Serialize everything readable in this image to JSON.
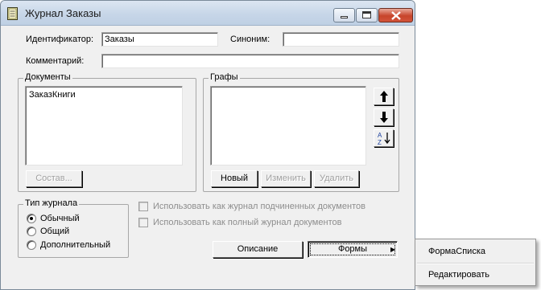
{
  "window": {
    "title": "Журнал Заказы"
  },
  "fields": {
    "identifier_label": "Идентификатор:",
    "identifier_value": "Заказы",
    "synonym_label": "Синоним:",
    "synonym_value": "",
    "comment_label": "Комментарий:",
    "comment_value": ""
  },
  "documents": {
    "title": "Документы",
    "items": [
      "ЗаказКниги"
    ],
    "compose_button": "Состав..."
  },
  "columns": {
    "title": "Графы",
    "items": [],
    "new_button": "Новый",
    "edit_button": "Изменить",
    "delete_button": "Удалить"
  },
  "journal_type": {
    "title": "Тип журнала",
    "options": [
      {
        "label": "Обычный",
        "checked": true
      },
      {
        "label": "Общий",
        "checked": false
      },
      {
        "label": "Дополнительный",
        "checked": false
      }
    ]
  },
  "checkboxes": {
    "subordinate": "Использовать как журнал подчиненных документов",
    "full": "Использовать как полный журнал документов"
  },
  "bottom_buttons": {
    "description": "Описание",
    "forms": "Формы"
  },
  "context_menu": {
    "items": [
      "ФормаСписка",
      "Редактировать"
    ]
  },
  "icons": [
    "journal-icon",
    "arrow-up-icon",
    "arrow-down-icon",
    "sort-az-icon",
    "submenu-arrow-icon"
  ]
}
